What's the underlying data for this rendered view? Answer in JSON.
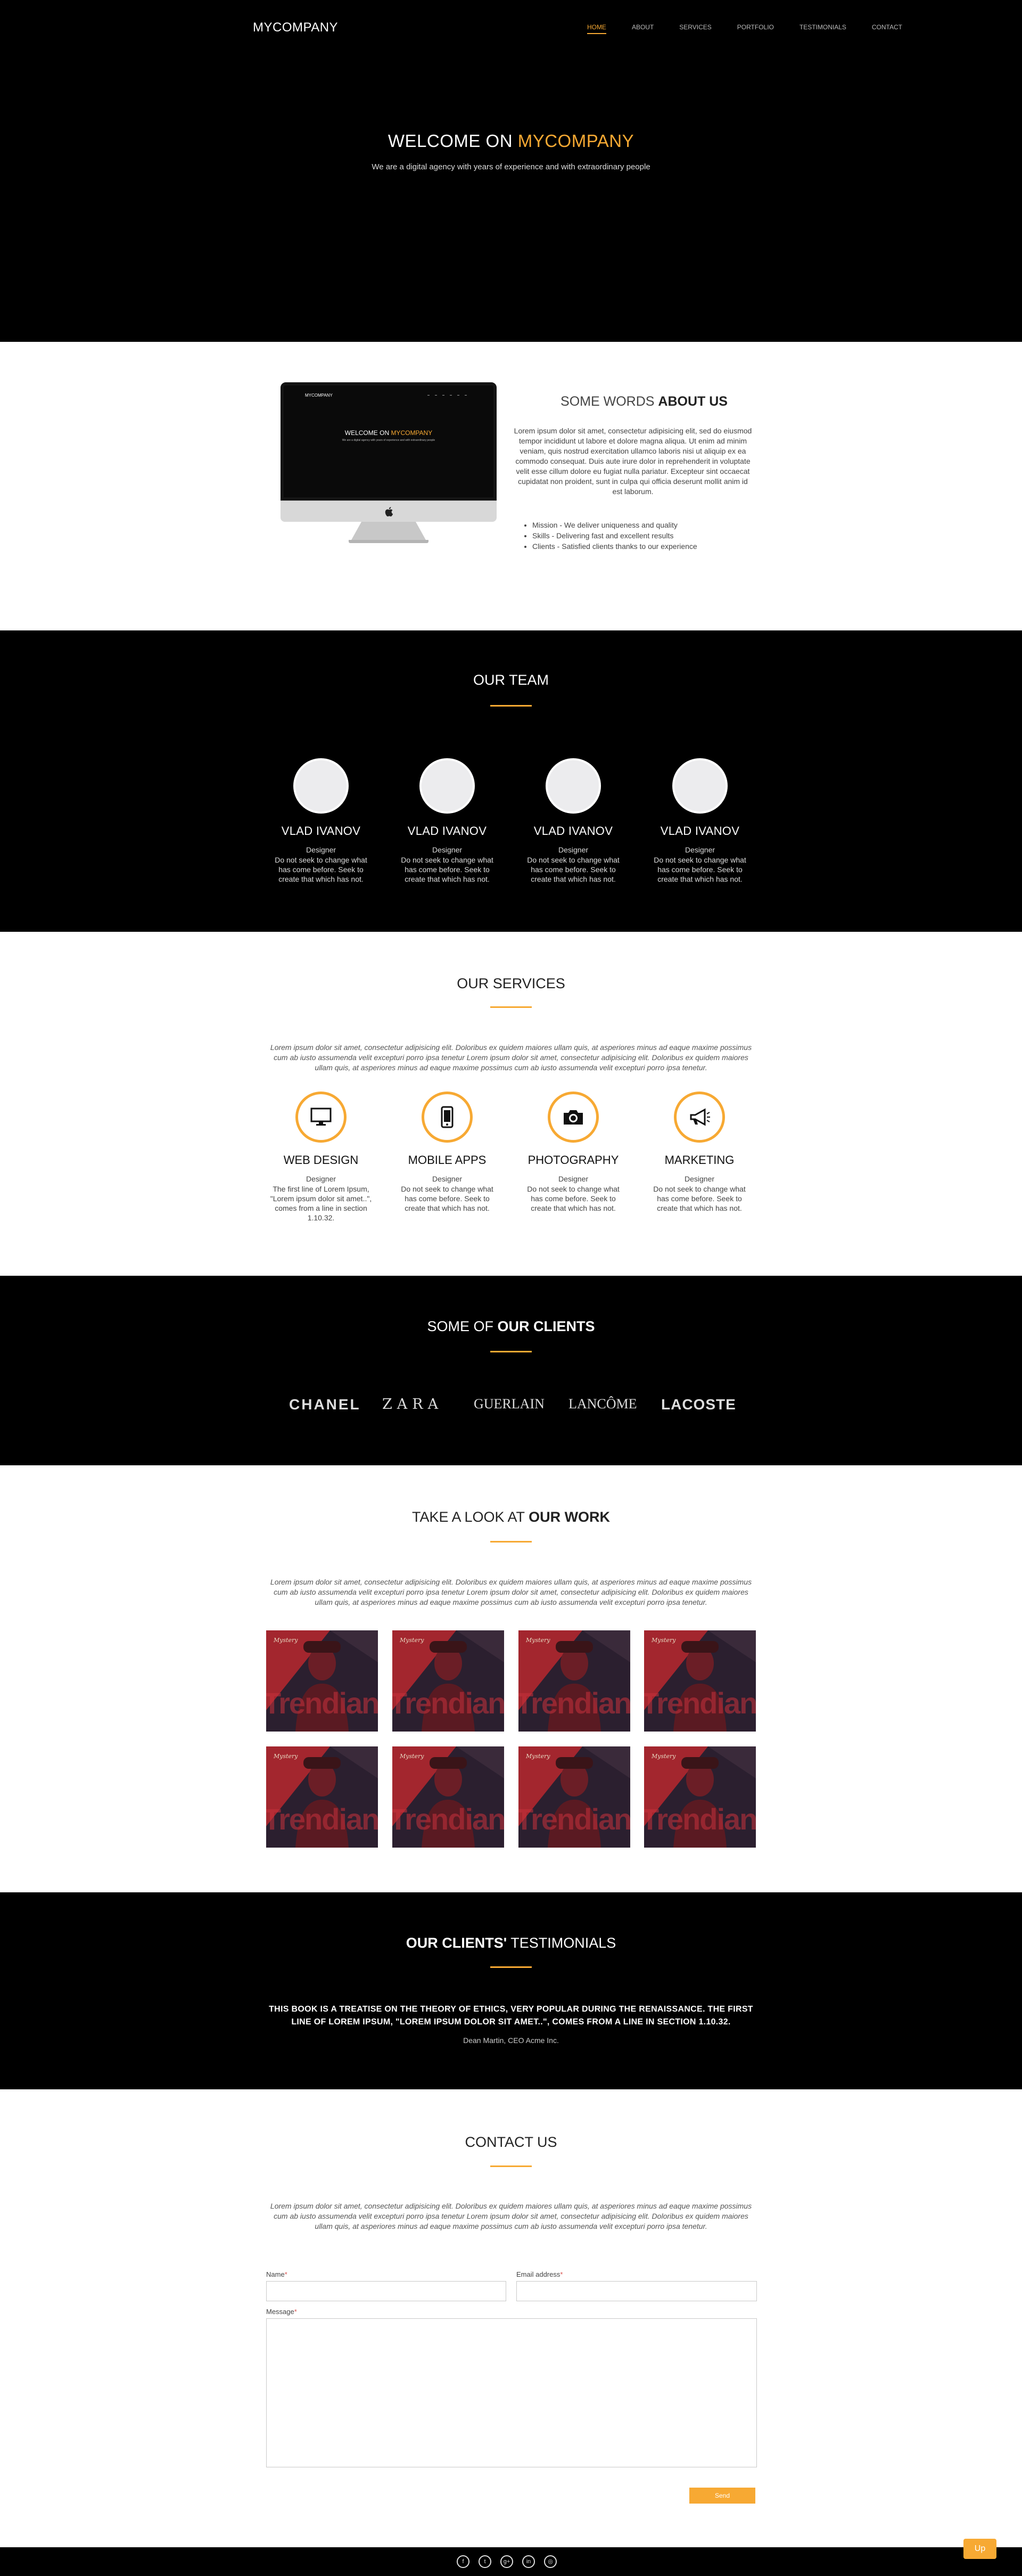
{
  "nav": {
    "brand": "MYCOMPANY",
    "links": [
      "HOME",
      "ABOUT",
      "SERVICES",
      "PORTFOLIO",
      "TESTIMONIALS",
      "CONTACT"
    ]
  },
  "hero": {
    "title_prefix": "WELCOME ON ",
    "title_highlight": "MYCOMPANY",
    "subtitle": "We are a digital agency with years of experience and with extraordinary people"
  },
  "about": {
    "title_light": "SOME WORDS ",
    "title_bold": "ABOUT US",
    "text": "Lorem ipsum dolor sit amet, consectetur adipisicing elit, sed do eiusmod tempor incididunt ut labore et dolore magna aliqua. Ut enim ad minim veniam, quis nostrud exercitation ullamco laboris nisi ut aliquip ex ea commodo consequat. Duis aute irure dolor in reprehenderit in voluptate velit esse cillum dolore eu fugiat nulla pariatur. Excepteur sint occaecat cupidatat non proident, sunt in culpa qui officia deserunt mollit anim id est laborum.",
    "list": [
      "Mission - We deliver uniqueness and quality",
      "Skills - Delivering fast and excellent results",
      "Clients - Satisfied clients thanks to our experience"
    ]
  },
  "team": {
    "title": "OUR TEAM",
    "members": [
      {
        "name": "VLAD IVANOV",
        "role": "Designer",
        "desc": "Do not seek to change what has come before. Seek to create that which has not."
      },
      {
        "name": "VLAD IVANOV",
        "role": "Designer",
        "desc": "Do not seek to change what has come before. Seek to create that which has not."
      },
      {
        "name": "VLAD IVANOV",
        "role": "Designer",
        "desc": "Do not seek to change what has come before. Seek to create that which has not."
      },
      {
        "name": "VLAD IVANOV",
        "role": "Designer",
        "desc": "Do not seek to change what has come before. Seek to create that which has not."
      }
    ]
  },
  "services": {
    "title": "OUR SERVICES",
    "intro": "Lorem ipsum dolor sit amet, consectetur adipisicing elit. Doloribus ex quidem maiores ullam quis, at asperiores minus ad eaque maxime possimus cum ab iusto assumenda velit excepturi porro ipsa tenetur Lorem ipsum dolor sit amet, consectetur adipisicing elit. Doloribus ex quidem maiores ullam quis, at asperiores minus ad eaque maxime possimus cum ab iusto assumenda velit excepturi porro ipsa tenetur.",
    "items": [
      {
        "icon": "monitor-icon",
        "name": "WEB DESIGN",
        "role": "Designer",
        "desc": "The first line of Lorem Ipsum, \"Lorem ipsum dolor sit amet..\", comes from a line in section 1.10.32."
      },
      {
        "icon": "mobile-icon",
        "name": "MOBILE APPS",
        "role": "Designer",
        "desc": "Do not seek to change what has come before. Seek to create that which has not."
      },
      {
        "icon": "camera-icon",
        "name": "PHOTOGRAPHY",
        "role": "Designer",
        "desc": "Do not seek to change what has come before. Seek to create that which has not."
      },
      {
        "icon": "megaphone-icon",
        "name": "MARKETING",
        "role": "Designer",
        "desc": "Do not seek to change what has come before. Seek to create that which has not."
      }
    ]
  },
  "clients": {
    "title_light": "SOME OF ",
    "title_bold": "OUR CLIENTS",
    "logos": [
      "CHANEL",
      "ZARA",
      "GUERLAIN",
      "LANCÔME",
      "LACOSTE"
    ]
  },
  "work": {
    "title_light": "TAKE A LOOK AT ",
    "title_bold": "OUR WORK",
    "intro": "Lorem ipsum dolor sit amet, consectetur adipisicing elit. Doloribus ex quidem maiores ullam quis, at asperiores minus ad eaque maxime possimus cum ab iusto assumenda velit excepturi porro ipsa tenetur Lorem ipsum dolor sit amet, consectetur adipisicing elit. Doloribus ex quidem maiores ullam quis, at asperiores minus ad eaque maxime possimus cum ab iusto assumenda velit excepturi porro ipsa tenetur.",
    "tile_label": "Mystery",
    "tile_word": "Trendian",
    "tile_count": 8
  },
  "testimonials": {
    "title_bold": "OUR CLIENTS'",
    "title_light": " TESTIMONIALS",
    "quote": "THIS BOOK IS A TREATISE ON THE THEORY OF ETHICS, VERY POPULAR DURING THE RENAISSANCE. THE FIRST LINE OF LOREM IPSUM, \"LOREM IPSUM DOLOR SIT AMET..\", COMES FROM A LINE IN SECTION 1.10.32.",
    "author": "Dean Martin, CEO Acme Inc."
  },
  "contact": {
    "title": "CONTACT US",
    "intro": "Lorem ipsum dolor sit amet, consectetur adipisicing elit. Doloribus ex quidem maiores ullam quis, at asperiores minus ad eaque maxime possimus cum ab iusto assumenda velit excepturi porro ipsa tenetur Lorem ipsum dolor sit amet, consectetur adipisicing elit. Doloribus ex quidem maiores ullam quis, at asperiores minus ad eaque maxime possimus cum ab iusto assumenda velit excepturi porro ipsa tenetur.",
    "name_label": "Name",
    "email_label": "Email address",
    "message_label": "Message",
    "required_mark": "*",
    "send_label": "Send"
  },
  "footer": {
    "social": [
      "f",
      "t",
      "g+",
      "in",
      "◎"
    ],
    "social_names": [
      "facebook-icon",
      "twitter-icon",
      "google-plus-icon",
      "linkedin-icon",
      "instagram-icon"
    ],
    "up_label": "Up"
  },
  "colors": {
    "accent": "#f7a933",
    "dark": "#000000"
  }
}
